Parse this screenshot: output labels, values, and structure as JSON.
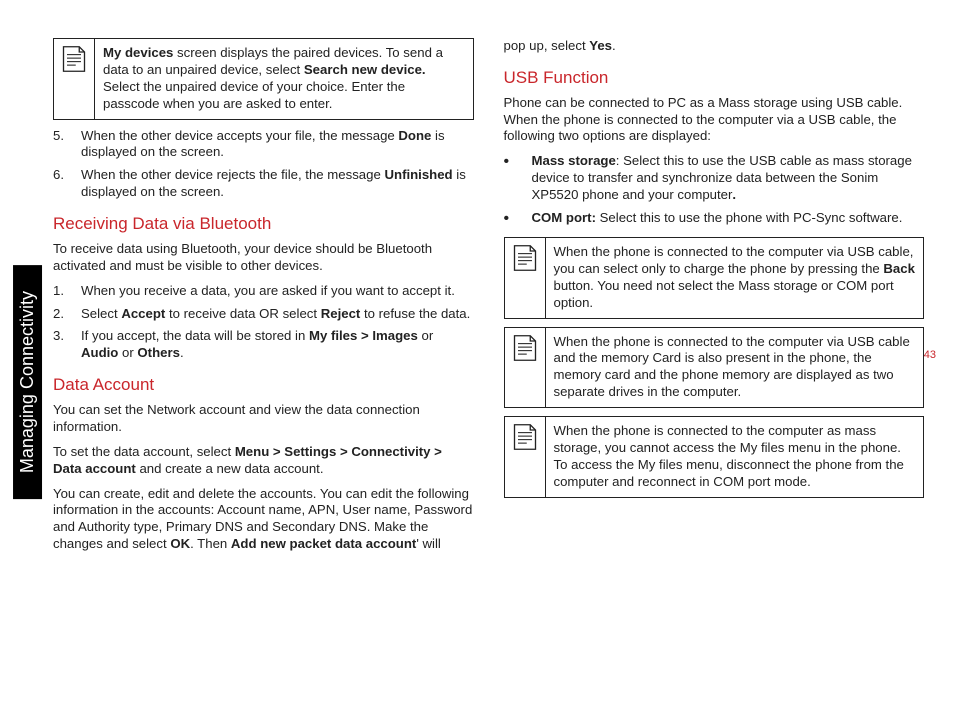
{
  "sidebar_label": "Managing  Connectivity",
  "page_number": "43",
  "left": {
    "note1_a": "My devices",
    "note1_b": " screen displays the paired devices. To send a data to an unpaired device, select ",
    "note1_c": "Search new device.",
    "note1_d": " Select the unpaired device of your choice. Enter the passcode when you are asked to enter.",
    "ol_a": {
      "n1": "5.",
      "t1_a": "When the other device accepts your file, the message ",
      "t1_b": "Done",
      "t1_c": " is displayed on the screen.",
      "n2": "6.",
      "t2_a": "When the other device rejects the file, the message ",
      "t2_b": "Unfinished",
      "t2_c": " is displayed on the screen."
    },
    "h1": "Receiving Data via Bluetooth",
    "p1": "To receive data using Bluetooth, your device should be Bluetooth activated and must be visible to other devices.",
    "ol_b": {
      "n1": "1.",
      "t1": "When you receive a data, you are asked if you want to accept it.",
      "n2": "2.",
      "t2_a": "Select ",
      "t2_b": "Accept",
      "t2_c": " to receive data OR select ",
      "t2_d": "Reject",
      "t2_e": " to refuse the data.",
      "n3": "3.",
      "t3_a": "If you accept, the data will be stored in ",
      "t3_b": "My files > Images",
      "t3_c": " or ",
      "t3_d": "Audio",
      "t3_e": " or ",
      "t3_f": "Others",
      "t3_g": "."
    },
    "h2": "Data Account",
    "p2": "You can set the Network account and view the data connection information.",
    "p3_a": "To set the data account, select ",
    "p3_b": "Menu > Settings > Connectivity > Data account",
    "p3_c": " and create a new data account.",
    "p4_a": "You can create, edit and delete the accounts. You can edit the following information in the accounts: Account name, APN, User name, Password and Authority type, Primary DNS and Secondary DNS. Make the changes and select ",
    "p4_b": "OK",
    "p4_c": ". Then ",
    "p4_d": "Add new packet data account",
    "p4_e": "' will"
  },
  "right": {
    "p0_a": "pop up, select ",
    "p0_b": "Yes",
    "p0_c": ".",
    "h1": "USB Function",
    "p1": "Phone can be connected to PC as a Mass storage using USB cable. When the phone is connected to the computer via a USB cable, the following two options are displayed:",
    "ul": {
      "b1_a": "Mass storage",
      "b1_b": ": Select this to use the USB cable as mass storage device to transfer and synchronize data between the Sonim XP5520 phone and your computer",
      "b1_c": ".",
      "b2_a": "COM port:",
      "b2_b": " Select this to use the phone with PC-Sync software."
    },
    "note1_a": "When the phone is connected to the computer via USB cable, you can select only to charge the phone by pressing the ",
    "note1_b": "Back",
    "note1_c": " button. You need not select the Mass storage or COM port option.",
    "note2": "When the phone is connected to the computer via USB cable and the memory Card is also present in the phone, the memory card and the phone memory are displayed as two separate drives in the computer.",
    "note3": "When the phone is connected to the computer as mass storage, you cannot access the My files menu in the phone. To access the My files menu, disconnect the phone from the computer and  reconnect in COM port mode."
  }
}
